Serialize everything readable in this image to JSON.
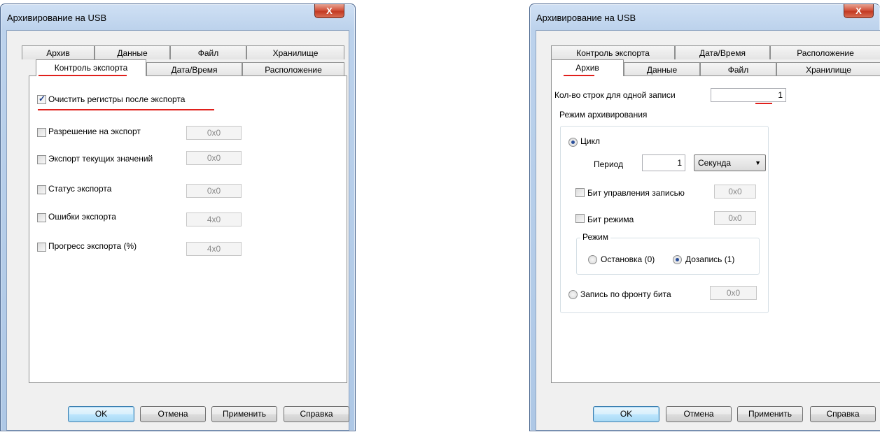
{
  "left_dialog": {
    "title": "Архивирование на USB",
    "close_glyph": "X",
    "tabs_row_back": [
      "Архив",
      "Данные",
      "Файл",
      "Хранилище"
    ],
    "tabs_row_front": [
      "Контроль экспорта",
      "Дата/Время",
      "Расположение"
    ],
    "selected_tab": "Контроль экспорта",
    "options": [
      {
        "label": "Очистить регистры после экспорта",
        "checked": true,
        "value": ""
      },
      {
        "label": "Разрешение на экспорт",
        "checked": false,
        "value": "0x0"
      },
      {
        "label": "Экспорт текущих значений",
        "checked": false,
        "value": "0x0"
      },
      {
        "label": "Статус экспорта",
        "checked": false,
        "value": "0x0"
      },
      {
        "label": "Ошибки экспорта",
        "checked": false,
        "value": "4x0"
      },
      {
        "label": "Прогресс экспорта (%)",
        "checked": false,
        "value": "4x0"
      }
    ],
    "buttons": {
      "ok": "OK",
      "cancel": "Отмена",
      "apply": "Применить",
      "help": "Справка"
    }
  },
  "right_dialog": {
    "title": "Архивирование на USB",
    "close_glyph": "X",
    "tabs_row_back": [
      "Контроль экспорта",
      "Дата/Время",
      "Расположение"
    ],
    "tabs_row_front": [
      "Архив",
      "Данные",
      "Файл",
      "Хранилище"
    ],
    "selected_tab": "Архив",
    "rows_label": "Кол-во строк для одной записи",
    "rows_value": "1",
    "mode_group_label": "Режим архивирования",
    "cycle_label": "Цикл",
    "cycle_selected": true,
    "period_label": "Период",
    "period_value": "1",
    "period_unit": "Секунда",
    "control_bit_label": "Бит управления записью",
    "control_bit_value": "0x0",
    "mode_bit_label": "Бит режима",
    "mode_bit_value": "0x0",
    "mode_sub_label": "Режим",
    "stop_label": "Остановка (0)",
    "append_label": "Дозапись (1)",
    "append_selected": true,
    "edge_label": "Запись по фронту бита",
    "edge_value": "0x0",
    "buttons": {
      "ok": "OK",
      "cancel": "Отмена",
      "apply": "Применить",
      "help": "Справка"
    }
  },
  "colors": {
    "annotation": "#e0201c",
    "frame": "#aec8e6",
    "close": "#c33a22"
  }
}
